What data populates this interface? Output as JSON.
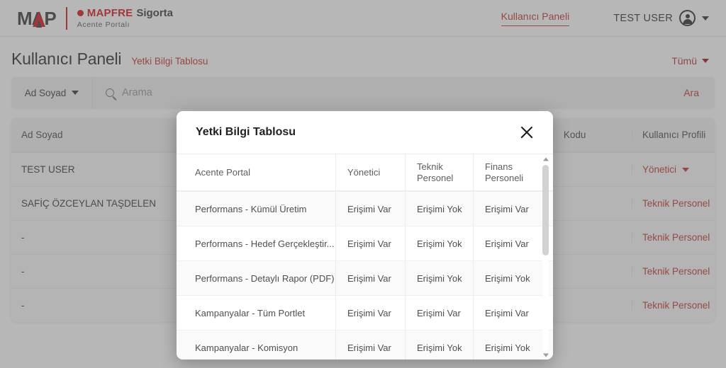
{
  "topbar": {
    "logo_text": "MAP",
    "brand_name": "MAPFRE",
    "brand_suffix": "Sigorta",
    "brand_subtitle": "Acente Portalı",
    "nav_link": "Kullanıcı Paneli",
    "user_name": "TEST USER",
    "avatar_icon": "user-avatar-icon",
    "caret_icon": "chevron-down-icon"
  },
  "header": {
    "page_title": "Kullanıcı Paneli",
    "badge_link": "Yetki Bilgi Tablosu",
    "filter_all": "Tümü"
  },
  "search": {
    "filter_label": "Ad Soyad",
    "placeholder": "Arama",
    "value": "",
    "submit_label": "Ara",
    "search_icon": "magnifier-icon"
  },
  "bg_table": {
    "columns": [
      "Ad Soyad",
      "",
      "Kodu",
      "Kullanıcı Profili"
    ],
    "rows": [
      {
        "name": "TEST USER",
        "mid": "",
        "kod": "",
        "profile": "Yönetici"
      },
      {
        "name": "SAFİÇ ÖZCEYLAN TAŞDELEN",
        "mid": "",
        "kod": "",
        "profile": "Teknik Personel"
      },
      {
        "name": "-",
        "mid": "",
        "kod": "",
        "profile": "Teknik Personel"
      },
      {
        "name": "-",
        "mid": "",
        "kod": "",
        "profile": "Teknik Personel"
      },
      {
        "name": "-",
        "mid": "",
        "kod": "",
        "profile": "Teknik Personel"
      }
    ]
  },
  "modal": {
    "title": "Yetki Bilgi Tablosu",
    "close_icon": "close-icon",
    "columns": [
      "Acente Portal",
      "Yönetici",
      "Teknik Personel",
      "Finans Personeli"
    ],
    "rows": [
      {
        "feature": "Performans - Kümül Üretim",
        "yonetici": "Erişimi Var",
        "teknik": "Erişimi Yok",
        "finans": "Erişimi Var"
      },
      {
        "feature": "Performans - Hedef Gerçekleştir...",
        "yonetici": "Erişimi Var",
        "teknik": "Erişimi Yok",
        "finans": "Erişimi Var"
      },
      {
        "feature": "Performans - Detaylı Rapor (PDF)",
        "yonetici": "Erişimi Var",
        "teknik": "Erişimi Yok",
        "finans": "Erişimi Yok"
      },
      {
        "feature": "Kampanyalar - Tüm Portlet",
        "yonetici": "Erişimi Var",
        "teknik": "Erişimi Var",
        "finans": "Erişimi Var"
      },
      {
        "feature": "Kampanyalar - Komisyon",
        "yonetici": "Erişimi Var",
        "teknik": "Erişimi Yok",
        "finans": "Erişimi Yok"
      }
    ],
    "scrollbar": {
      "up_icon": "scroll-up-arrow-icon",
      "down_icon": "scroll-down-arrow-icon"
    }
  },
  "colors": {
    "brand_red": "#d8141e",
    "accent_red": "#c0392b",
    "text_dark": "#2c2c2c",
    "overlay": "rgba(96,96,96,0.45)"
  }
}
